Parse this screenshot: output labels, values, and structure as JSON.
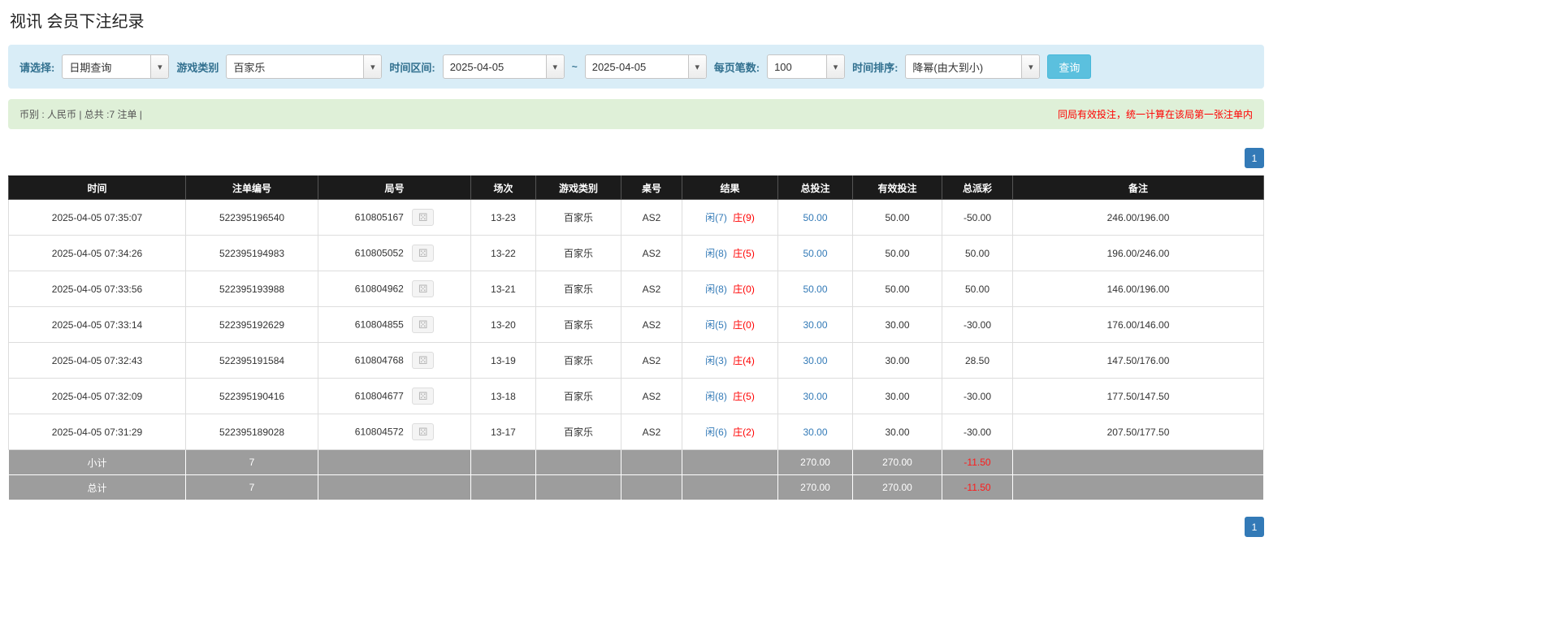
{
  "page": {
    "title": "视讯 会员下注纪录"
  },
  "icons": {
    "caret_down": "▾",
    "video_replay": "⚄"
  },
  "colors": {
    "accent_blue": "#337ab7",
    "search_button_blue": "#5bc0de",
    "negative_red": "#ff0000",
    "filter_bar_bg": "#d9edf7",
    "summary_bar_bg": "#dff0d8",
    "table_header_bg": "#1b1b1b",
    "footer_row_bg": "#9d9d9d"
  },
  "filters": {
    "select_label": "请选择:",
    "select_value": "日期查询",
    "game_type_label": "游戏类别",
    "game_type_value": "百家乐",
    "time_range_label": "时间区间:",
    "date_from": "2025-04-05",
    "range_separator": "~",
    "date_to": "2025-04-05",
    "page_size_label": "每页笔数:",
    "page_size_value": "100",
    "sort_label": "时间排序:",
    "sort_value": "降幂(由大到小)",
    "search_button": "查询"
  },
  "summary": {
    "left": "币别 : 人民币 | 总共 :7 注单 |",
    "right": "同局有效投注，统一计算在该局第一张注单内"
  },
  "pagination": {
    "current_page": "1"
  },
  "table": {
    "headers": [
      "时间",
      "注单编号",
      "局号",
      "场次",
      "游戏类别",
      "桌号",
      "结果",
      "总投注",
      "有效投注",
      "总派彩",
      "备注"
    ],
    "rows": [
      {
        "time": "2025-04-05 07:35:07",
        "bet_id": "522395196540",
        "round_id": "610805167",
        "session": "13-23",
        "game": "百家乐",
        "table": "AS2",
        "result_player": "闲(7)",
        "result_banker": "庄(9)",
        "total_bet": "50.00",
        "valid_bet": "50.00",
        "payout": "-50.00",
        "note": "246.00/196.00"
      },
      {
        "time": "2025-04-05 07:34:26",
        "bet_id": "522395194983",
        "round_id": "610805052",
        "session": "13-22",
        "game": "百家乐",
        "table": "AS2",
        "result_player": "闲(8)",
        "result_banker": "庄(5)",
        "total_bet": "50.00",
        "valid_bet": "50.00",
        "payout": "50.00",
        "note": "196.00/246.00"
      },
      {
        "time": "2025-04-05 07:33:56",
        "bet_id": "522395193988",
        "round_id": "610804962",
        "session": "13-21",
        "game": "百家乐",
        "table": "AS2",
        "result_player": "闲(8)",
        "result_banker": "庄(0)",
        "total_bet": "50.00",
        "valid_bet": "50.00",
        "payout": "50.00",
        "note": "146.00/196.00"
      },
      {
        "time": "2025-04-05 07:33:14",
        "bet_id": "522395192629",
        "round_id": "610804855",
        "session": "13-20",
        "game": "百家乐",
        "table": "AS2",
        "result_player": "闲(5)",
        "result_banker": "庄(0)",
        "total_bet": "30.00",
        "valid_bet": "30.00",
        "payout": "-30.00",
        "note": "176.00/146.00"
      },
      {
        "time": "2025-04-05 07:32:43",
        "bet_id": "522395191584",
        "round_id": "610804768",
        "session": "13-19",
        "game": "百家乐",
        "table": "AS2",
        "result_player": "闲(3)",
        "result_banker": "庄(4)",
        "total_bet": "30.00",
        "valid_bet": "30.00",
        "payout": "28.50",
        "note": "147.50/176.00"
      },
      {
        "time": "2025-04-05 07:32:09",
        "bet_id": "522395190416",
        "round_id": "610804677",
        "session": "13-18",
        "game": "百家乐",
        "table": "AS2",
        "result_player": "闲(8)",
        "result_banker": "庄(5)",
        "total_bet": "30.00",
        "valid_bet": "30.00",
        "payout": "-30.00",
        "note": "177.50/147.50"
      },
      {
        "time": "2025-04-05 07:31:29",
        "bet_id": "522395189028",
        "round_id": "610804572",
        "session": "13-17",
        "game": "百家乐",
        "table": "AS2",
        "result_player": "闲(6)",
        "result_banker": "庄(2)",
        "total_bet": "30.00",
        "valid_bet": "30.00",
        "payout": "-30.00",
        "note": "207.50/177.50"
      }
    ],
    "subtotal": {
      "label": "小计",
      "count": "7",
      "total_bet": "270.00",
      "valid_bet": "270.00",
      "payout": "-11.50"
    },
    "total": {
      "label": "总计",
      "count": "7",
      "total_bet": "270.00",
      "valid_bet": "270.00",
      "payout": "-11.50"
    }
  }
}
